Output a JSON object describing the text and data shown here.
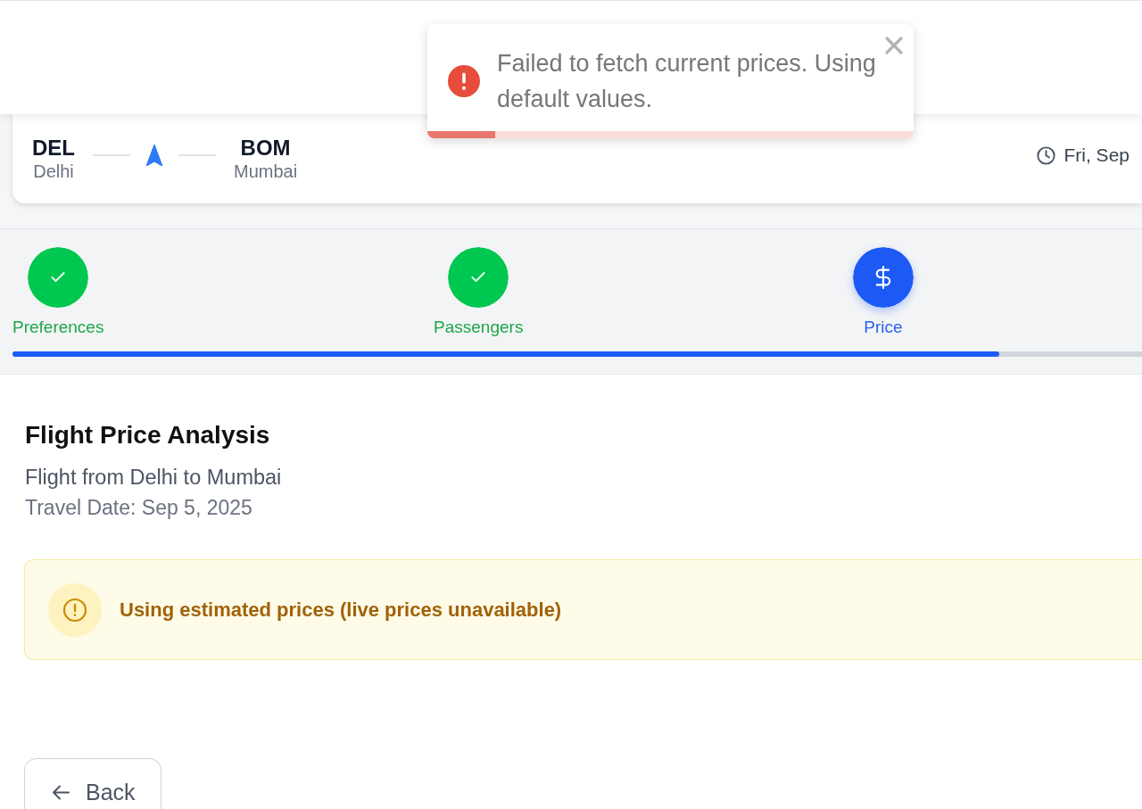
{
  "toast": {
    "message": "Failed to fetch current prices. Using default values.",
    "level": 0.14
  },
  "route": {
    "origin": {
      "code": "DEL",
      "city": "Delhi"
    },
    "destination": {
      "code": "BOM",
      "city": "Mumbai"
    },
    "date": "Fri, Sep"
  },
  "steps": [
    {
      "label": "Preferences",
      "completed": true,
      "current": false
    },
    {
      "label": "Passengers",
      "completed": true,
      "current": false
    },
    {
      "label": "Price",
      "completed": false,
      "current": true
    }
  ],
  "progress": {
    "level": 0.874
  },
  "analysis": {
    "title": "Flight Price Analysis",
    "route": "Flight from Delhi to Mumbai",
    "travel_date": "Travel Date: Sep 5, 2025"
  },
  "notice": {
    "message": "Using estimated prices (live prices unavailable)"
  },
  "back_button": {
    "label": "Back"
  }
}
